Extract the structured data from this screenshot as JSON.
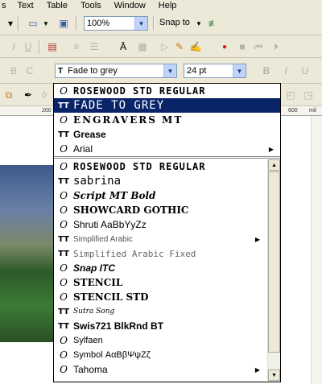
{
  "menubar": {
    "items": [
      "s",
      "Text",
      "Table",
      "Tools",
      "Window",
      "Help"
    ]
  },
  "toolbar1": {
    "zoom_value": "100%",
    "snap_label": "Snap to"
  },
  "toolbar3": {
    "font_value": "Fade to grey",
    "size_value": "24 pt"
  },
  "ruler": {
    "ticks": [
      "200",
      "600",
      "mil"
    ]
  },
  "font_list": {
    "recent": [
      {
        "name": "ROSEWOOD STD REGULAR",
        "icon": "O",
        "selected": false,
        "submenu": false
      },
      {
        "name": "FADE TO GREY",
        "icon": "TT",
        "selected": true,
        "submenu": false
      },
      {
        "name": "ENGRAVERS MT",
        "icon": "O",
        "selected": false,
        "submenu": false
      },
      {
        "name": "Grease",
        "icon": "TT",
        "selected": false,
        "submenu": false
      },
      {
        "name": "Arial",
        "icon": "O",
        "selected": false,
        "submenu": true
      }
    ],
    "all": [
      {
        "name": "ROSEWOOD STD REGULAR",
        "icon": "O",
        "submenu": false
      },
      {
        "name": "sabrina",
        "icon": "TT",
        "submenu": false
      },
      {
        "name": "Script MT Bold",
        "icon": "O",
        "submenu": false
      },
      {
        "name": "SHOWCARD GOTHIC",
        "icon": "O",
        "submenu": false
      },
      {
        "name": "Shruti  AaBbYyZz",
        "icon": "O",
        "submenu": false
      },
      {
        "name": "Simplified Arabic",
        "icon": "TT",
        "submenu": true
      },
      {
        "name": "Simplified Arabic Fixed",
        "icon": "TT",
        "submenu": false
      },
      {
        "name": "Snap ITC",
        "icon": "O",
        "submenu": false
      },
      {
        "name": "STENCIL",
        "icon": "O",
        "submenu": false
      },
      {
        "name": "STENCIL STD",
        "icon": "O",
        "submenu": false
      },
      {
        "name": "Sutra Song",
        "icon": "TT",
        "submenu": false
      },
      {
        "name": "Swis721 BlkRnd BT",
        "icon": "TT",
        "submenu": false
      },
      {
        "name": "Sylfaen",
        "icon": "O",
        "submenu": false
      },
      {
        "name": "Symbol  ΑαΒβΨψΖζ",
        "icon": "O",
        "submenu": false
      },
      {
        "name": "Tahoma",
        "icon": "O",
        "submenu": true
      }
    ]
  },
  "colors": {
    "selection": "#0a246a",
    "toolbar_bg": "#ece9d8"
  }
}
